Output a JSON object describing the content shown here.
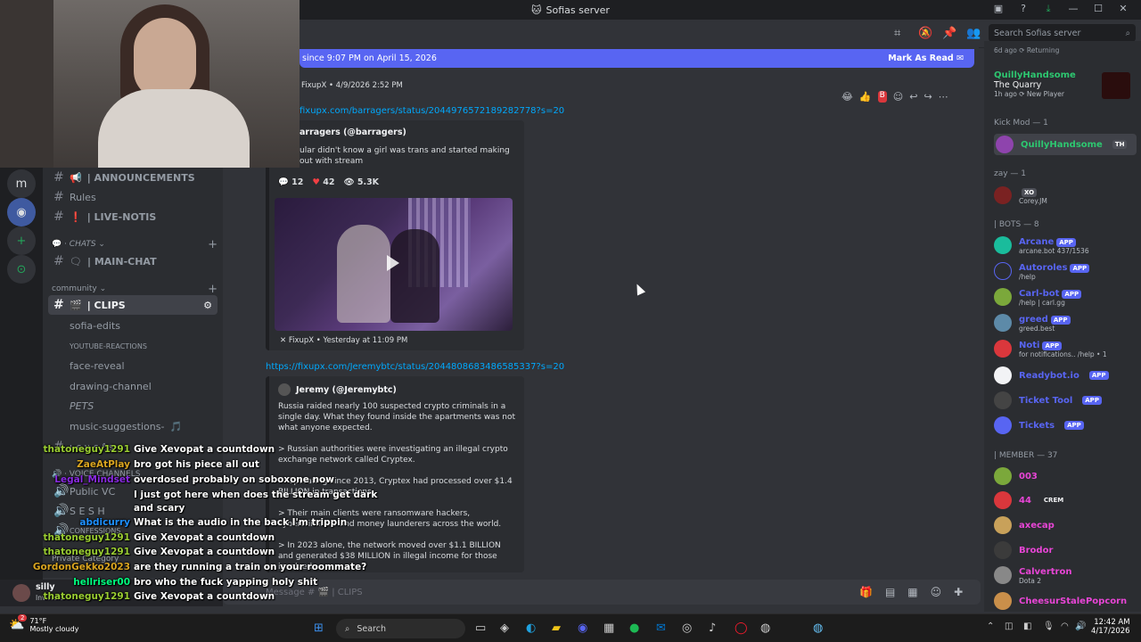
{
  "window": {
    "title": "Sofias server"
  },
  "new_messages": {
    "text": "since 9:07 PM on April 15, 2026",
    "action": "Mark As Read"
  },
  "sidebar": {
    "server_initial": "m",
    "channels": [
      {
        "label": "| ANNOUNCEMENTS",
        "emoji": "📢"
      },
      {
        "label": "Rules",
        "emoji": ""
      },
      {
        "label": "| LIVE-NOTIS",
        "emoji": "❗"
      },
      {
        "label": "| MAIN-CHAT",
        "emoji": "🗨"
      },
      {
        "label": "| CLIPS",
        "emoji": "🎬"
      },
      {
        "label": "sofia-edits",
        "emoji": ""
      },
      {
        "label": "YOUTUBE-REACTIONS",
        "emoji": ""
      },
      {
        "label": "face-reveal",
        "emoji": ""
      },
      {
        "label": "drawing-channel",
        "emoji": ""
      },
      {
        "label": "PETS",
        "emoji": ""
      },
      {
        "label": "music-suggestions-",
        "emoji": "🎵"
      },
      {
        "label": "ι є ν є ℓ ѕ",
        "emoji": ""
      }
    ],
    "categories": {
      "chats": "CHATS",
      "community": "community",
      "voice": "VOICE CHANNELS"
    },
    "voice": [
      {
        "label": "Public VC"
      },
      {
        "label": "S E S H"
      },
      {
        "label": "CONFESSIONS"
      }
    ],
    "private": "Private Category",
    "user": {
      "name": "silly",
      "status": "Invisible"
    }
  },
  "messages": {
    "first_meta": "FixupX • 4/9/2026 2:52 PM",
    "first_link": "fixupx.com/barragers/status/2044976572189282778?s=20",
    "embed1": {
      "author": "arragers (@barragers)",
      "desc": "ular didn't know a girl was trans and started making out with stream",
      "replies": "12",
      "likes": "42",
      "views": "5.3K",
      "footer": "FixupX • Yesterday at 11:09 PM"
    },
    "second_link": "https://fixupx.com/Jeremybtc/status/2044808683486585337?s=20",
    "embed2": {
      "author": "Jeremy (@Jeremybtc)",
      "p1": "Russia raided nearly 100 suspected crypto criminals in a single day. What they found inside the apartments was not what anyone expected.",
      "p2": "> Russian authorities were investigating an illegal crypto exchange network called Cryptex.",
      "p3": "> Operating since 2013, Cryptex had processed over $1.4 BILLION in transactions.",
      "p4": "> Their main clients were ransomware hackers, cybercriminals and money launderers across the world.",
      "p5": "> In 2023 alone, the network moved over $1.1 BILLION and generated $38 MILLION in illegal income for those involved."
    },
    "composer_placeholder": "Message # 🎬 | CLIPS"
  },
  "members": {
    "search_placeholder": "Search Sofias server",
    "top_status": "6d ago  ⟳ Returning",
    "quilly_game": {
      "name": "QuillyHandsome",
      "game": "The Quarry",
      "sub": "1h ago  ⟳ New Player"
    },
    "groups": [
      {
        "title": "Kick Mod — 1",
        "items": [
          {
            "name": "QuillyHandsome",
            "sub": "",
            "badge": "TH",
            "color": "#2dc770"
          }
        ]
      },
      {
        "title": "zay — 1",
        "items": [
          {
            "name": "",
            "sub": "Corey.JM",
            "badge": "XO",
            "color": "#f2f3f5"
          }
        ]
      },
      {
        "title": "| BOTS — 8",
        "items": [
          {
            "name": "Arcane",
            "sub": "arcane.bot 437/1536",
            "badge": "APP",
            "color": "#5865f2"
          },
          {
            "name": "Autoroles",
            "sub": "/help",
            "badge": "APP",
            "color": "#5865f2"
          },
          {
            "name": "Carl-bot",
            "sub": "/help | carl.gg",
            "badge": "APP",
            "color": "#5865f2"
          },
          {
            "name": "greed",
            "sub": "greed.best",
            "badge": "APP",
            "color": "#5865f2"
          },
          {
            "name": "Noti",
            "sub": "for notifications.. /help • 1",
            "badge": "APP",
            "color": "#5865f2"
          },
          {
            "name": "Readybot.io",
            "sub": "",
            "badge": "APP",
            "color": "#5865f2"
          },
          {
            "name": "Ticket Tool",
            "sub": "",
            "badge": "APP",
            "color": "#5865f2"
          },
          {
            "name": "Tickets",
            "sub": "",
            "badge": "APP",
            "color": "#5865f2"
          }
        ]
      },
      {
        "title": "| MEMBER — 37",
        "items": [
          {
            "name": "003",
            "sub": "",
            "badge": "",
            "color": "#e845d6"
          },
          {
            "name": "44",
            "sub": "",
            "badge": "CREM",
            "color": "#e845d6"
          },
          {
            "name": "axecap",
            "sub": "",
            "badge": "",
            "color": "#e845d6"
          },
          {
            "name": "Brodor",
            "sub": "",
            "badge": "",
            "color": "#e845d6"
          },
          {
            "name": "Calvertron",
            "sub": "Dota 2",
            "badge": "",
            "color": "#e845d6"
          },
          {
            "name": "CheesurStalePopcorn",
            "sub": "",
            "badge": "",
            "color": "#e845d6"
          }
        ]
      }
    ]
  },
  "twitch_chat": [
    {
      "user": "thatoneguy1291",
      "msg": "Give Xevopat a countdown",
      "color": "#9acd32"
    },
    {
      "user": "ZaeAtPlay",
      "msg": "bro got his piece all out",
      "color": "#daa520"
    },
    {
      "user": "Legal_Mindset",
      "msg": "overdosed probably on soboxone now",
      "color": "#8a2be2"
    },
    {
      "user": "",
      "msg": "I just got here when does the stream get dark",
      "color": "#ff4500"
    },
    {
      "user": "",
      "msg": "and scary",
      "color": "#ff4500"
    },
    {
      "user": "abdicurry",
      "msg": "What is the audio in the back I'm trippin",
      "color": "#1e90ff"
    },
    {
      "user": "thatoneguy1291",
      "msg": "Give Xevopat a countdown",
      "color": "#9acd32"
    },
    {
      "user": "thatoneguy1291",
      "msg": "Give Xevopat a countdown",
      "color": "#9acd32"
    },
    {
      "user": "GordonGekko2023",
      "msg": "are they running a train on your roommate?",
      "color": "#daa520"
    },
    {
      "user": "hellriser00",
      "msg": "bro who the fuck yapping holy shit",
      "color": "#00ff7f"
    },
    {
      "user": "thatoneguy1291",
      "msg": "Give Xevopat a countdown",
      "color": "#9acd32"
    }
  ],
  "taskbar": {
    "weather_temp": "71°F",
    "weather_desc": "Mostly cloudy",
    "search": "Search",
    "time": "12:42 AM",
    "date": "4/17/2026",
    "notification_count": "2"
  }
}
